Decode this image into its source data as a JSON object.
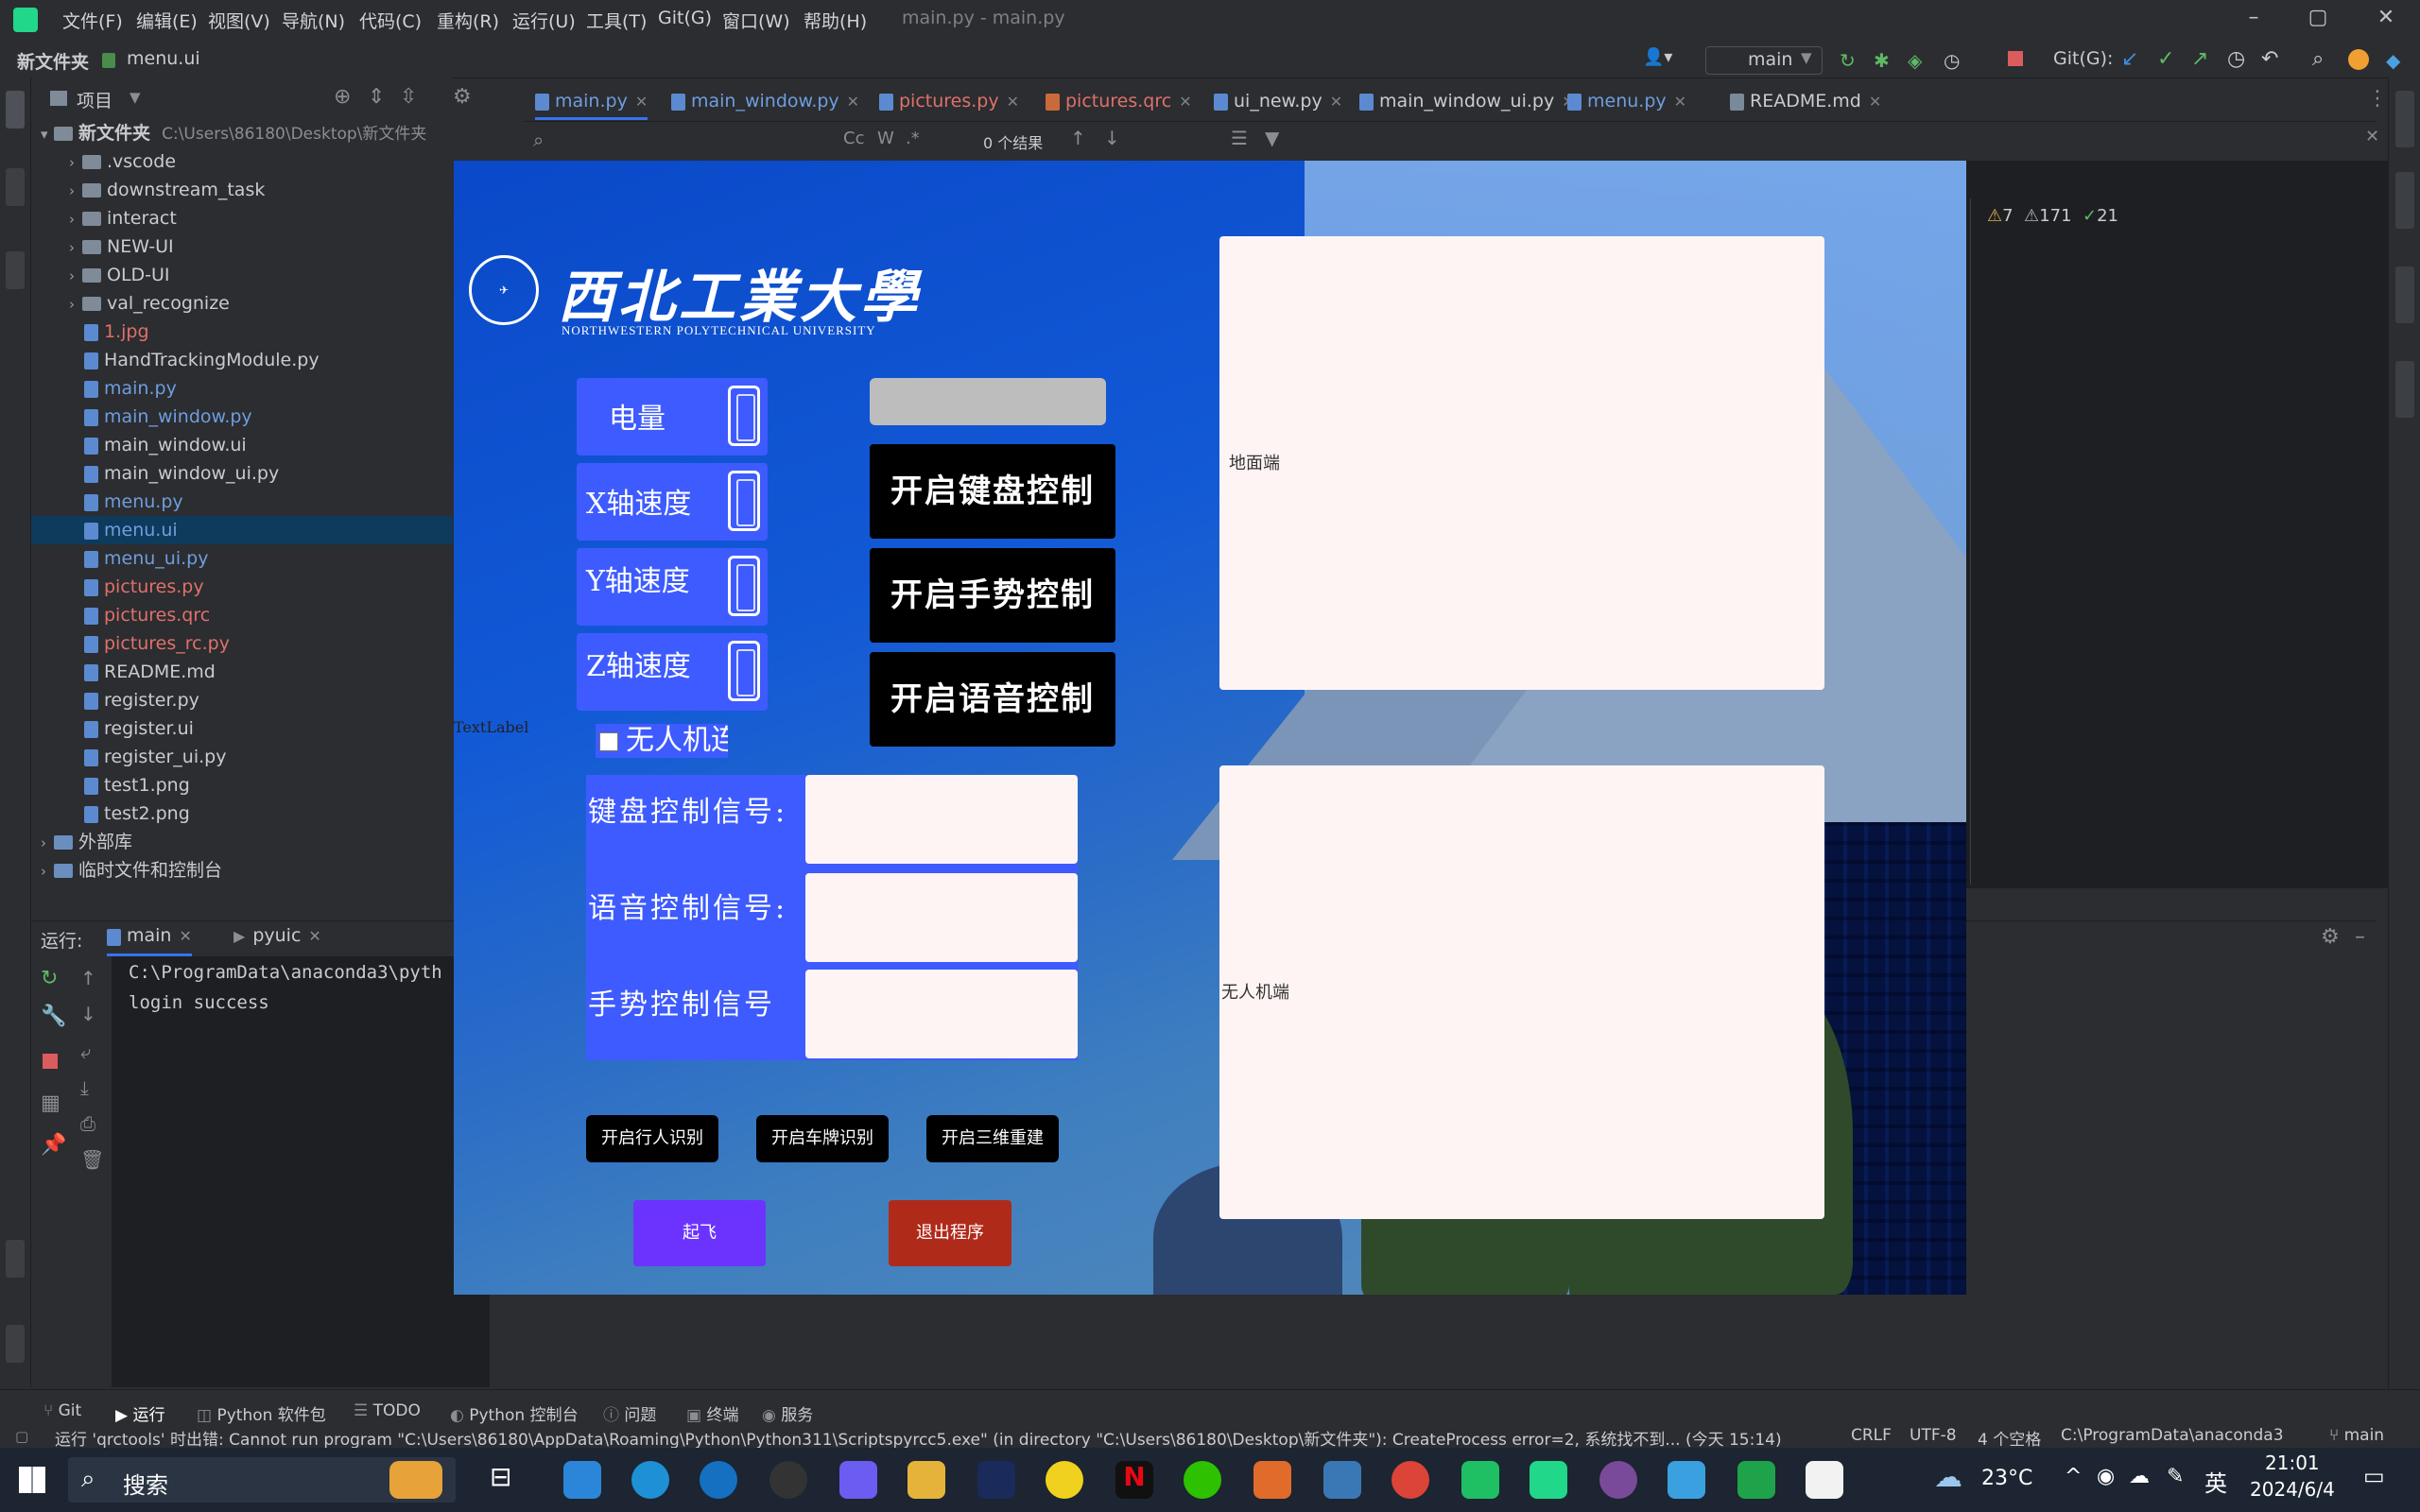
{
  "titlebar": {
    "menus": [
      "文件(F)",
      "编辑(E)",
      "视图(V)",
      "导航(N)",
      "代码(C)",
      "重构(R)",
      "运行(U)",
      "工具(T)",
      "Git(G)",
      "窗口(W)",
      "帮助(H)"
    ],
    "window_title": "main.py - main.py"
  },
  "navbar": {
    "breadcrumb_root": "新文件夹",
    "breadcrumb_file": "menu.ui",
    "run_config": "main",
    "git_label": "Git(G):"
  },
  "project": {
    "panel_title": "项目",
    "root_name": "新文件夹",
    "root_path": "C:\\Users\\86180\\Desktop\\新文件夹",
    "items": [
      {
        "name": ".vscode",
        "type": "folder"
      },
      {
        "name": "downstream_task",
        "type": "folder"
      },
      {
        "name": "interact",
        "type": "folder"
      },
      {
        "name": "NEW-UI",
        "type": "folder"
      },
      {
        "name": "OLD-UI",
        "type": "folder"
      },
      {
        "name": "val_recognize",
        "type": "folder"
      },
      {
        "name": "1.jpg",
        "type": "file"
      },
      {
        "name": "HandTrackingModule.py",
        "type": "file"
      },
      {
        "name": "main.py",
        "type": "file"
      },
      {
        "name": "main_window.py",
        "type": "file"
      },
      {
        "name": "main_window.ui",
        "type": "file"
      },
      {
        "name": "main_window_ui.py",
        "type": "file"
      },
      {
        "name": "menu.py",
        "type": "file"
      },
      {
        "name": "menu.ui",
        "type": "file"
      },
      {
        "name": "menu_ui.py",
        "type": "file"
      },
      {
        "name": "pictures.py",
        "type": "file"
      },
      {
        "name": "pictures.qrc",
        "type": "file"
      },
      {
        "name": "pictures_rc.py",
        "type": "file"
      },
      {
        "name": "README.md",
        "type": "file"
      },
      {
        "name": "register.py",
        "type": "file"
      },
      {
        "name": "register.ui",
        "type": "file"
      },
      {
        "name": "register_ui.py",
        "type": "file"
      },
      {
        "name": "test1.png",
        "type": "file"
      },
      {
        "name": "test2.png",
        "type": "file"
      }
    ],
    "external_libs": "外部库",
    "scratches": "临时文件和控制台"
  },
  "tabs": [
    "main.py",
    "main_window.py",
    "pictures.py",
    "pictures.qrc",
    "ui_new.py",
    "main_window_ui.py",
    "menu.py",
    "README.md"
  ],
  "findbar": {
    "results": "0 个结果"
  },
  "inspections": {
    "warn1": "7",
    "warn2": "171",
    "ok": "21"
  },
  "run": {
    "label": "运行:",
    "tab_main": "main",
    "tab_pyuic": "pyuic",
    "console_lines": [
      "C:\\ProgramData\\anaconda3\\pyth",
      "login success"
    ]
  },
  "statusbar": {
    "tools": [
      "Git",
      "运行",
      "Python 软件包",
      "TODO",
      "Python 控制台",
      "问题",
      "终端",
      "服务"
    ],
    "message": "运行 'qrctools' 时出错: Cannot run program \"C:\\Users\\86180\\AppData\\Roaming\\Python\\Python311\\Scriptspyrcc5.exe\" (in directory \"C:\\Users\\86180\\Desktop\\新文件夹\"): CreateProcess error=2, 系统找不到... (今天 15:14)",
    "line_sep": "CRLF",
    "encoding": "UTF-8",
    "indent": "4 个空格",
    "interpreter": "C:\\ProgramData\\anaconda3",
    "branch": "main"
  },
  "app": {
    "logo_cn": "西北工業大學",
    "logo_en": "NORTHWESTERN POLYTECHNICAL UNIVERSITY",
    "stats": [
      "电量",
      "X轴速度",
      "Y轴速度",
      "Z轴速度"
    ],
    "buttons": [
      "开启键盘控制",
      "开启手势控制",
      "开启语音控制"
    ],
    "checkbox_label": "无人机连",
    "textlabel": "TextLabel",
    "signals": [
      "键盘控制信号:",
      "语音控制信号:",
      "手势控制信号"
    ],
    "small_buttons": [
      "开启行人识别",
      "开启车牌识别",
      "开启三维重建"
    ],
    "takeoff": "起飞",
    "quit": "退出程序",
    "ground_label": "地面端",
    "drone_label": "无人机端"
  },
  "taskbar": {
    "search": "搜索",
    "weather": "23°C",
    "ime": "英",
    "time": "21:01",
    "date": "2024/6/4"
  }
}
